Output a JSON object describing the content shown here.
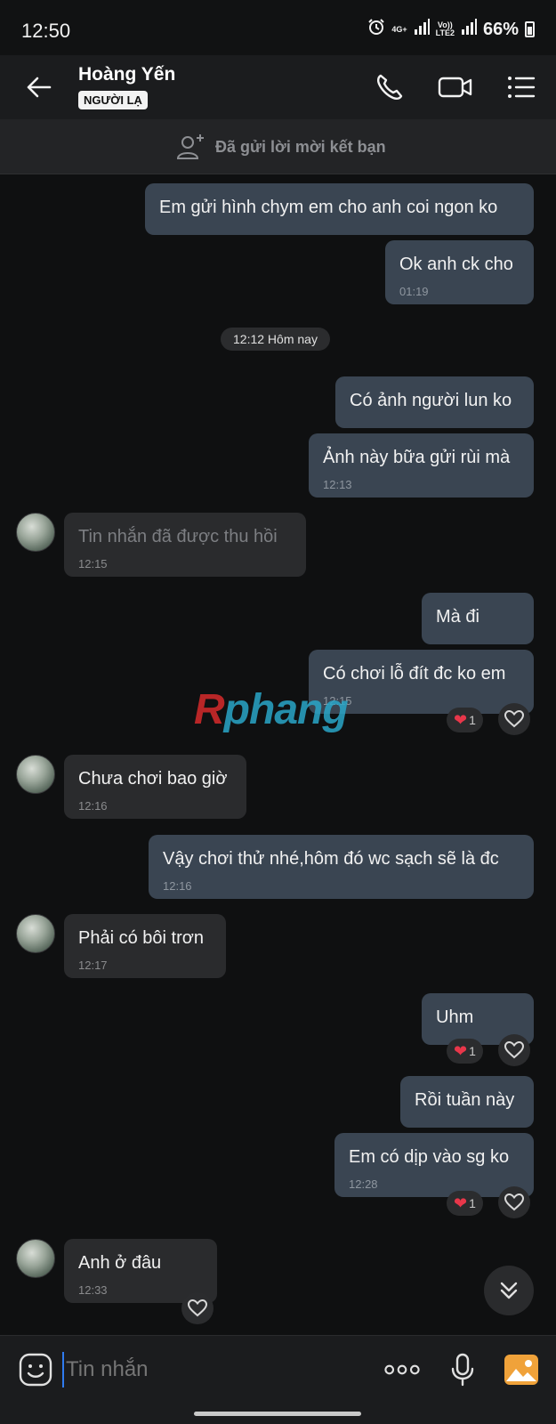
{
  "status_bar": {
    "time": "12:50",
    "network": "4G+",
    "volte_top": "Vo))",
    "volte_bottom": "LTE2",
    "battery": "66%"
  },
  "header": {
    "contact_name": "Hoàng Yến",
    "badge": "NGƯỜI LẠ"
  },
  "friend_bar": {
    "text": "Đã gửi lời mời kết bạn"
  },
  "time_divider": "12:12 Hôm nay",
  "messages": [
    {
      "text": "Em gửi hình chym em cho anh coi ngon ko",
      "time": ""
    },
    {
      "text": "Ok anh ck cho",
      "time": "01:19"
    },
    {
      "text": "Có ảnh người lun ko",
      "time": ""
    },
    {
      "text": "Ảnh này bữa gửi rùi mà",
      "time": "12:13"
    },
    {
      "text": "Tin nhắn đã được thu hồi",
      "time": "12:15"
    },
    {
      "text": "Mà đi",
      "time": ""
    },
    {
      "text": "Có chơi lỗ đít đc ko em",
      "time": "12:15"
    },
    {
      "text": "Chưa chơi bao giờ",
      "time": "12:16"
    },
    {
      "text": "Vậy chơi thử nhé,hôm đó wc sạch sẽ là đc",
      "time": "12:16"
    },
    {
      "text": "Phải có bôi trơn",
      "time": "12:17"
    },
    {
      "text": "Uhm",
      "time": ""
    },
    {
      "text": "Rồi tuần này",
      "time": ""
    },
    {
      "text": "Em có dịp vào sg ko",
      "time": "12:28"
    },
    {
      "text": "Anh ở đâu",
      "time": "12:33"
    }
  ],
  "reaction_count": "1",
  "watermark": {
    "first": "R",
    "rest": "phang"
  },
  "input": {
    "placeholder": "Tin nhắn"
  },
  "colors": {
    "outgoing_bubble": "#3a4552",
    "incoming_bubble": "#2a2b2d",
    "background": "#0f1011",
    "reaction_heart": "#e8374a",
    "image_button": "#f0a23a"
  }
}
